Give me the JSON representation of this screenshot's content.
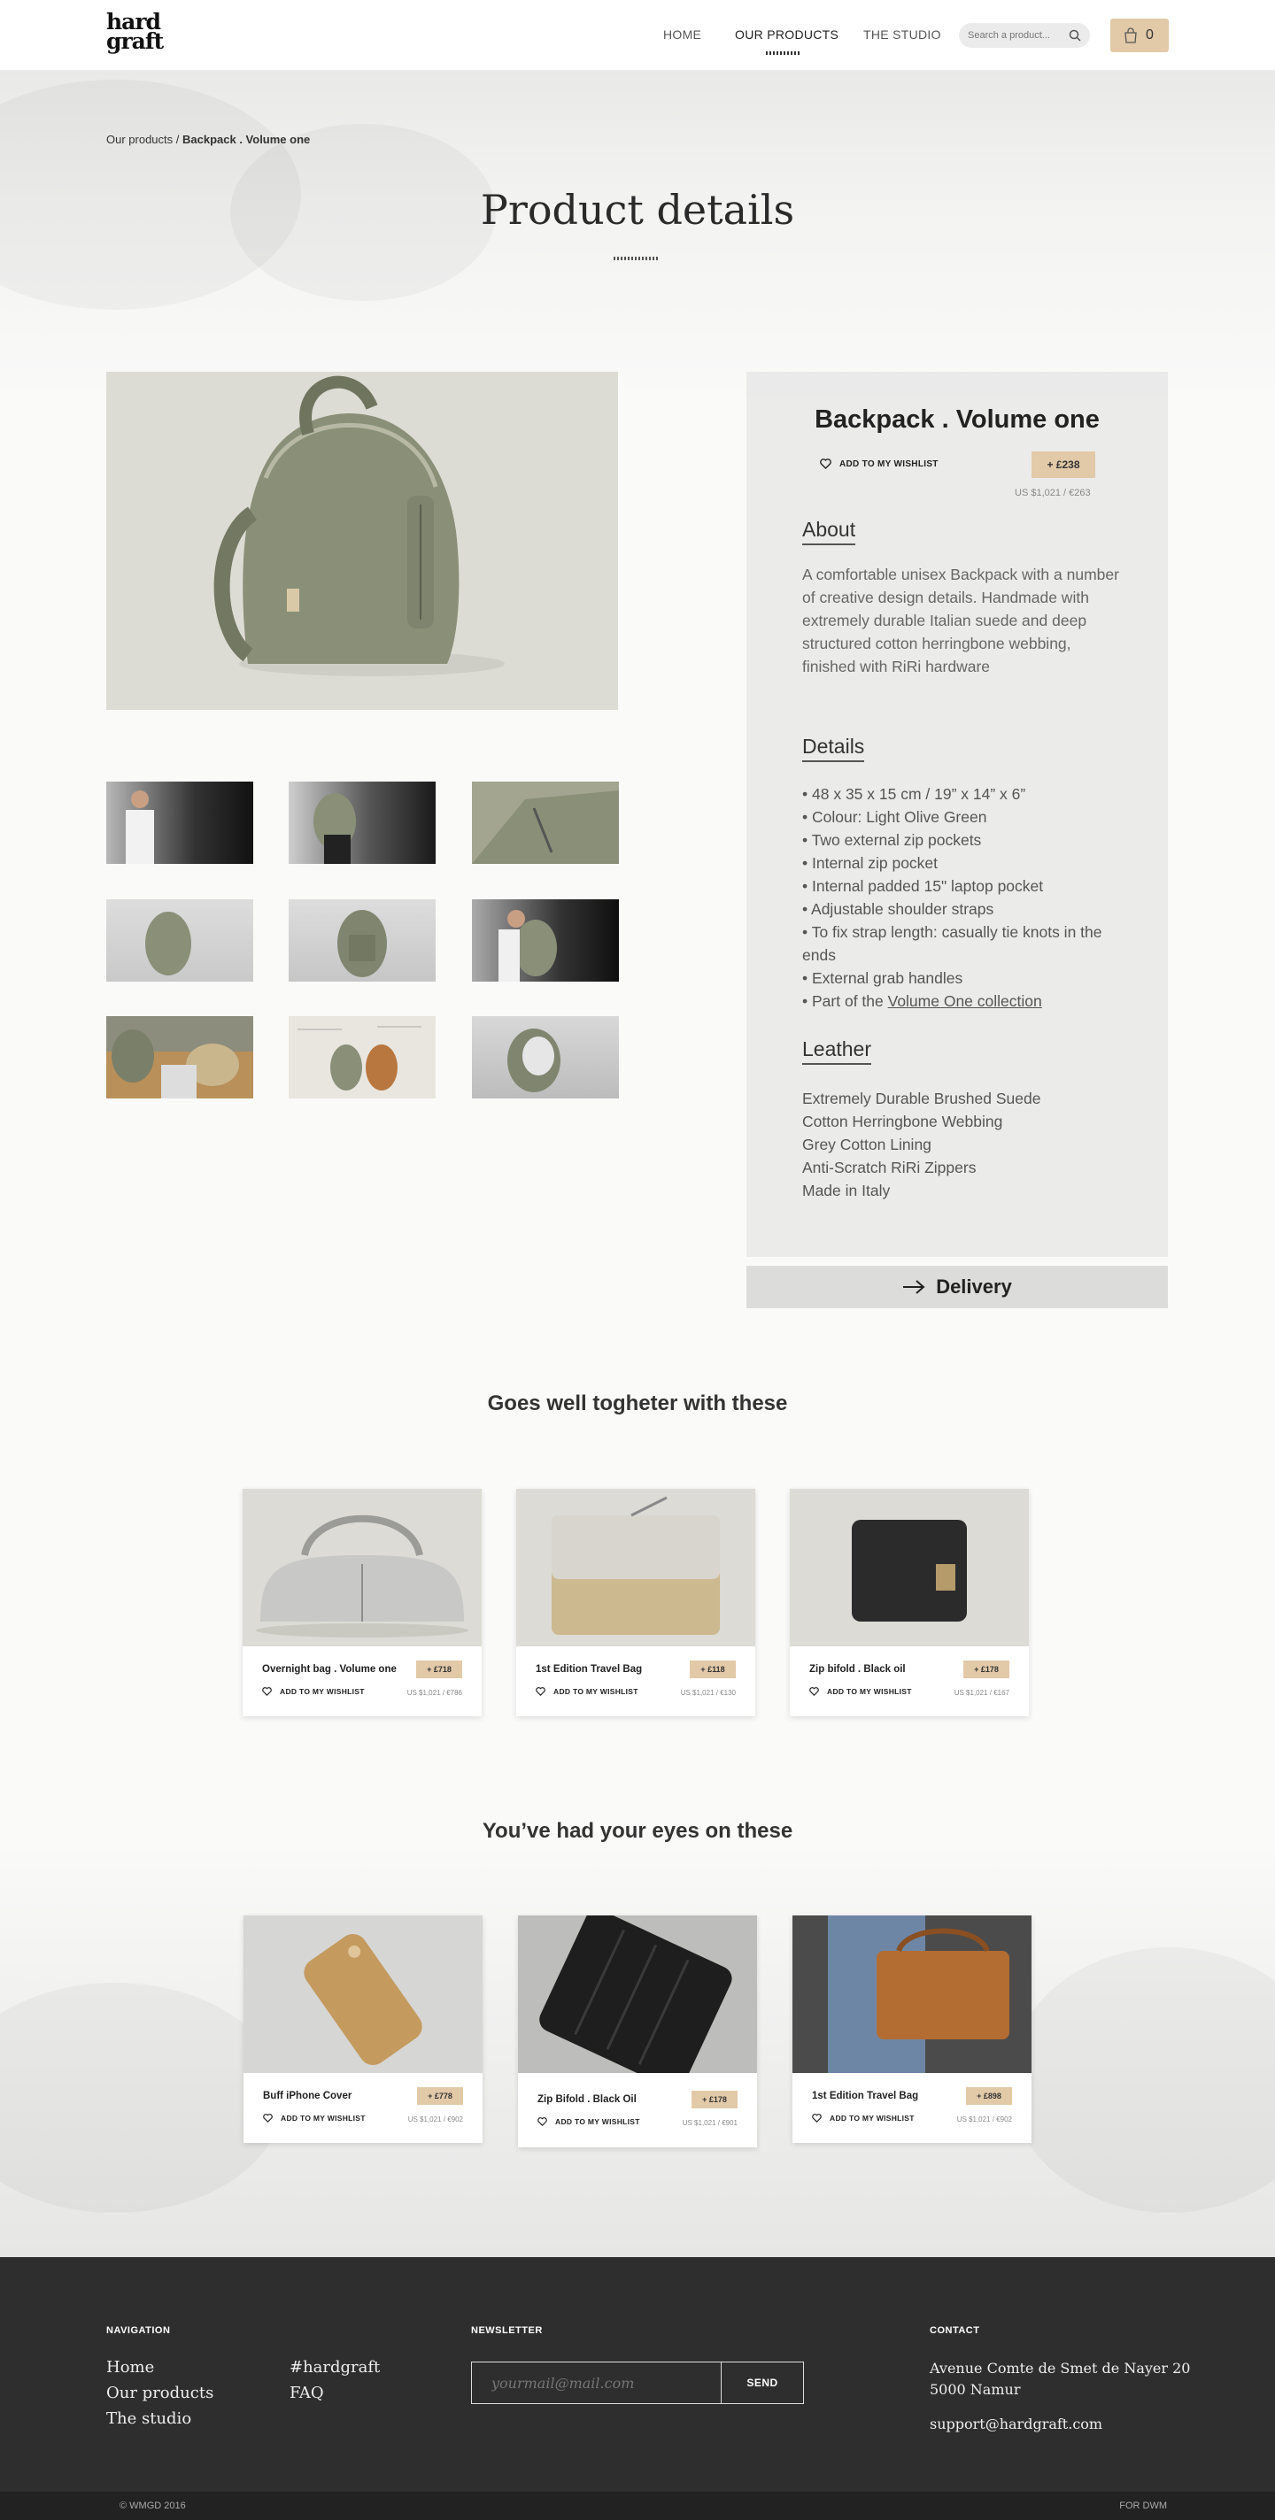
{
  "header": {
    "logo_line1": "hard",
    "logo_line2": "graft",
    "nav": [
      "HOME",
      "OUR PRODUCTS",
      "THE STUDIO"
    ],
    "search_placeholder": "Search a product...",
    "cart_count": "0"
  },
  "breadcrumb": {
    "parent": "Our products",
    "sep": " / ",
    "current": "Backpack . Volume one"
  },
  "page_title": "Product details",
  "product": {
    "name": "Backpack . Volume one",
    "wishlist_label": "ADD TO MY WISHLIST",
    "price": "+ £238",
    "price_other": "US $1,021 / €263",
    "about_heading": "About",
    "about_text": "A comfortable unisex Backpack with a number of creative design details. Handmade with extremely durable Italian suede and deep structured cotton herringbone webbing, finished with RiRi hardware",
    "details_heading": "Details",
    "details": [
      "48 x 35 x 15 cm / 19” x 14” x 6”",
      "Colour: Light Olive Green",
      "Two external zip pockets",
      "Internal zip pocket",
      "Internal padded 15\" laptop pocket",
      "Adjustable shoulder straps",
      "To fix strap length: casually tie knots in the ends",
      "External grab handles"
    ],
    "details_last_prefix": "Part of the ",
    "details_last_link": "Volume One collection",
    "leather_heading": "Leather",
    "leather": [
      "Extremely Durable Brushed Suede",
      "Cotton Herringbone Webbing",
      "Grey Cotton Lining",
      "Anti-Scratch RiRi Zippers",
      "Made in Italy"
    ]
  },
  "delivery_label": "Delivery",
  "goes_well_title": "Goes well togheter with these",
  "goes_well": [
    {
      "name": "Overnight bag . Volume one",
      "price": "+ £718",
      "sub": "US $1,021 / €786"
    },
    {
      "name": "1st Edition Travel Bag",
      "price": "+ £118",
      "sub": "US $1,021 / €130"
    },
    {
      "name": "Zip bifold . Black oil",
      "price": "+ £178",
      "sub": "US $1,021 / €167"
    }
  ],
  "eyes_title": "You’ve had your eyes on these",
  "eyes": [
    {
      "name": "Buff iPhone Cover",
      "price": "+ £778",
      "sub": "US $1,021 / €902"
    },
    {
      "name": "Zip Bifold . Black Oil",
      "price": "+ £178",
      "sub": "US $1,021 / €901"
    },
    {
      "name": "1st Edition Travel Bag",
      "price": "+ £898",
      "sub": "US $1,021 / €902"
    }
  ],
  "card_wishlist": "ADD TO MY WISHLIST",
  "footer": {
    "nav_heading": "NAVIGATION",
    "nav_col1": [
      "Home",
      "Our products",
      "The studio"
    ],
    "nav_col2": [
      "#hardgraft",
      "FAQ"
    ],
    "newsletter_heading": "NEWSLETTER",
    "newsletter_placeholder": "yourmail@mail.com",
    "send_label": "SEND",
    "contact_heading": "CONTACT",
    "address1": "Avenue Comte de Smet de Nayer 20",
    "address2": "5000 Namur",
    "email": "support@hardgraft.com",
    "copyright": "© WMGD 2016",
    "credit": "FOR DWM"
  },
  "colors": {
    "accent": "#e2c9a8",
    "footer": "#2e2e2e",
    "olive": "#8a8f78"
  }
}
